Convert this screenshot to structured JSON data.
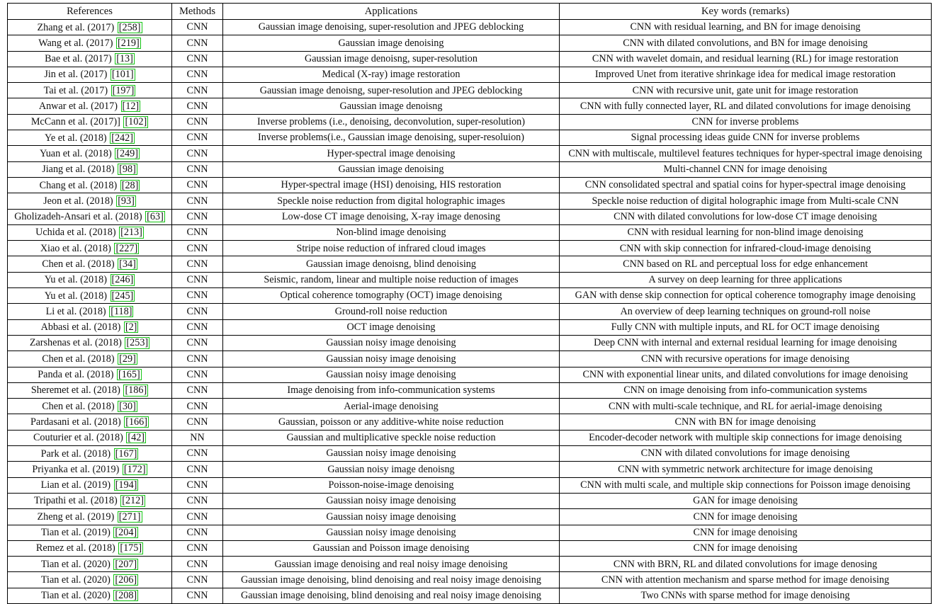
{
  "table": {
    "columns": [
      "References",
      "Methods",
      "Applications",
      "Key words (remarks)"
    ],
    "rows": [
      {
        "author": "Zhang et al. (2017)",
        "cite": "258",
        "method": "CNN",
        "application": "Gaussian image denoising, super-resolution and JPEG deblocking",
        "keywords": "CNN with residual learning, and BN for image denoising"
      },
      {
        "author": "Wang et al. (2017)",
        "cite": "219",
        "method": "CNN",
        "application": "Gaussian image denoising",
        "keywords": "CNN with dilated convolutions, and BN for image denoising"
      },
      {
        "author": "Bae et al. (2017)",
        "cite": "13",
        "method": "CNN",
        "application": "Gaussian image denoisng, super-resolution",
        "keywords": "CNN with wavelet domain, and residual learning (RL) for image restoration"
      },
      {
        "author": "Jin et al. (2017)",
        "cite": "101",
        "method": "CNN",
        "application": "Medical (X-ray) image restoration",
        "keywords": "Improved Unet from iterative shrinkage idea for medical image restoration"
      },
      {
        "author": "Tai et al. (2017)",
        "cite": "197",
        "method": "CNN",
        "application": "Gaussian image denoisng, super-resolution and JPEG deblocking",
        "keywords": "CNN with recursive unit, gate unit for image restoration"
      },
      {
        "author": "Anwar et al. (2017)",
        "cite": "12",
        "method": "CNN",
        "application": "Gaussian image denoisng",
        "keywords": "CNN with fully connected layer, RL and dilated convolutions for image denoising"
      },
      {
        "author": "McCann et al. (2017)]",
        "cite": "102",
        "method": "CNN",
        "application": "Inverse problems (i.e., denoising, deconvolution, super-resolution)",
        "keywords": "CNN for inverse problems"
      },
      {
        "author": "Ye et al. (2018)",
        "cite": "242",
        "method": "CNN",
        "application": "Inverse problems(i.e., Gaussian image denoising, super-resoluion)",
        "keywords": "Signal processing ideas guide CNN for inverse problems"
      },
      {
        "author": "Yuan et al. (2018)",
        "cite": "249",
        "method": "CNN",
        "application": "Hyper-spectral image denoising",
        "keywords": "CNN with multiscale, multilevel features techniques for hyper-spectral image denoising"
      },
      {
        "author": "Jiang et al. (2018)",
        "cite": "98",
        "method": "CNN",
        "application": "Gaussian image denoising",
        "keywords": "Multi-channel CNN for image denoising"
      },
      {
        "author": "Chang et al. (2018)",
        "cite": "28",
        "method": "CNN",
        "application": "Hyper-spectral image (HSI) denoising, HIS restoration",
        "keywords": "CNN consolidated spectral and spatial coins for hyper-spectral image denoising"
      },
      {
        "author": "Jeon et al. (2018)",
        "cite": "93",
        "method": "CNN",
        "application": "Speckle noise reduction from digital holographic images",
        "keywords": "Speckle noise reduction of digital holographic image from Multi-scale CNN"
      },
      {
        "author": "Gholizadeh-Ansari et al. (2018)",
        "cite": "63",
        "method": "CNN",
        "application": "Low-dose CT image denoising, X-ray image denosing",
        "keywords": "CNN with dilated convolutions for low-dose CT image denoising"
      },
      {
        "author": "Uchida et al. (2018)",
        "cite": "213",
        "method": "CNN",
        "application": "Non-blind image denoising",
        "keywords": "CNN with residual learning for non-blind image denoising"
      },
      {
        "author": "Xiao et al. (2018)",
        "cite": "227",
        "method": "CNN",
        "application": "Stripe noise reduction of infrared cloud images",
        "keywords": "CNN with skip connection for infrared-cloud-image denoising"
      },
      {
        "author": "Chen et al. (2018)",
        "cite": "34",
        "method": "CNN",
        "application": "Gaussian image denoisng, blind denoising",
        "keywords": "CNN based on RL and perceptual loss for edge enhancement"
      },
      {
        "author": "Yu et al. (2018)",
        "cite": "246",
        "method": "CNN",
        "application": "Seismic, random, linear and multiple noise reduction of images",
        "keywords": "A survey on deep learning for three applications"
      },
      {
        "author": "Yu et al. (2018)",
        "cite": "245",
        "method": "CNN",
        "application": "Optical coherence tomography (OCT) image denoising",
        "keywords": "GAN with dense skip connection for optical coherence tomography image denoising"
      },
      {
        "author": "Li et al. (2018)",
        "cite": "118",
        "method": "CNN",
        "application": "Ground-roll noise reduction",
        "keywords": "An overview of deep learning techniques on ground-roll noise"
      },
      {
        "author": "Abbasi et al. (2018)",
        "cite": "2",
        "method": "CNN",
        "application": "OCT image denoising",
        "keywords": "Fully CNN with multiple inputs, and RL for OCT image denoising"
      },
      {
        "author": "Zarshenas et al. (2018)",
        "cite": "253",
        "method": "CNN",
        "application": "Gaussian noisy image denoising",
        "keywords": "Deep CNN with internal and external residual learning for image denoising"
      },
      {
        "author": "Chen et al. (2018)",
        "cite": "29",
        "method": "CNN",
        "application": "Gaussian noisy image denoising",
        "keywords": "CNN with recursive operations for image denoising"
      },
      {
        "author": "Panda et al. (2018)",
        "cite": "165",
        "method": "CNN",
        "application": "Gaussian noisy image denoising",
        "keywords": "CNN with exponential linear units, and dilated convolutions for image denoising"
      },
      {
        "author": "Sheremet et al. (2018)",
        "cite": "186",
        "method": "CNN",
        "application": "Image denoising from info-communication systems",
        "keywords": "CNN on image denoising from info-communication systems"
      },
      {
        "author": "Chen et al. (2018)",
        "cite": "30",
        "method": "CNN",
        "application": "Aerial-image denoising",
        "keywords": "CNN with multi-scale technique, and RL for aerial-image denoising"
      },
      {
        "author": "Pardasani et al. (2018)",
        "cite": "166",
        "method": "CNN",
        "application": "Gaussian, poisson or any additive-white noise reduction",
        "keywords": "CNN with BN for image denoising"
      },
      {
        "author": "Couturier et al. (2018)",
        "cite": "42",
        "method": "NN",
        "application": "Gaussian and multiplicative speckle noise reduction",
        "keywords": "Encoder-decoder network with multiple skip connections for image denoising"
      },
      {
        "author": "Park et al. (2018)",
        "cite": "167",
        "method": "CNN",
        "application": "Gaussian noisy image denoising",
        "keywords": "CNN with dilated convolutions for image denoising"
      },
      {
        "author": "Priyanka et al. (2019)",
        "cite": "172",
        "method": "CNN",
        "application": "Gaussian noisy image denoisng",
        "keywords": "CNN with symmetric network architecture for image denoising"
      },
      {
        "author": "Lian et al. (2019)",
        "cite": "194",
        "method": "CNN",
        "application": "Poisson-noise-image denoising",
        "keywords": "CNN with multi scale, and multiple skip connections for Poisson image denoising"
      },
      {
        "author": "Tripathi et al. (2018)",
        "cite": "212",
        "method": "CNN",
        "application": "Gaussian noisy image denoising",
        "keywords": "GAN for image denoising"
      },
      {
        "author": "Zheng et al. (2019)",
        "cite": "271",
        "method": "CNN",
        "application": "Gaussian noisy image denoising",
        "keywords": "CNN for image denoising"
      },
      {
        "author": "Tian et al. (2019)",
        "cite": "204",
        "method": "CNN",
        "application": "Gaussian noisy image denoising",
        "keywords": "CNN for image denoising"
      },
      {
        "author": "Remez et al. (2018)",
        "cite": "175",
        "method": "CNN",
        "application": "Gaussian and Poisson image denoising",
        "keywords": "CNN for image denoising"
      },
      {
        "author": "Tian et al. (2020)",
        "cite": "207",
        "method": "CNN",
        "application": "Gaussian image denoising and real noisy image denoising",
        "keywords": "CNN with BRN, RL and dilated convolutions for image denosing"
      },
      {
        "author": "Tian et al. (2020)",
        "cite": "206",
        "method": "CNN",
        "application": "Gaussian image denoising, blind denoising and real noisy image denoising",
        "keywords": "CNN with attention mechanism and sparse method for image denoising"
      },
      {
        "author": "Tian et al. (2020)",
        "cite": "208",
        "method": "CNN",
        "application": "Gaussian image denoising, blind denoising and real noisy image denoising",
        "keywords": "Two CNNs with sparse method for image denoising"
      }
    ]
  },
  "style": {
    "citation_link_color": "#13c413",
    "text_color": "#111111",
    "border_color": "#000000"
  }
}
